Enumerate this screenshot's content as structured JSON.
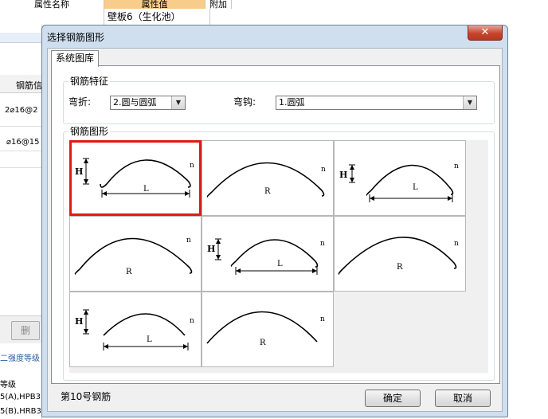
{
  "background": {
    "header_col1": "属性名称",
    "header_col2": "属性值",
    "header_col3": "附加",
    "row_value": "壁板6（生化池）",
    "left_col_header": "钢筋信",
    "left_cell1": "2⌀16@2",
    "left_cell2": "⌀16@15",
    "left_button": "删",
    "left_link": "二强度等级",
    "left_text1": "等级",
    "left_text2": "5(A),HPB3",
    "left_text3": "5(B),HRB3"
  },
  "dialog": {
    "title": "选择钢筋图形",
    "close_symbol": "✕",
    "tab_label": "系统图库",
    "features_group_label": "钢筋特征",
    "bend_label": "弯折:",
    "bend_value": "2.圆与圆弧",
    "hook_label": "弯钩:",
    "hook_value": "1.圆弧",
    "shapes_group_label": "钢筋图形",
    "status": "第10号钢筋",
    "ok_label": "确定",
    "cancel_label": "取消",
    "selected_color": "#e01818",
    "icons": {
      "dropdown": "chevron-down-icon",
      "close": "close-icon"
    }
  },
  "shapes": [
    {
      "labels": [
        "H",
        "L",
        "n"
      ],
      "selected": true
    },
    {
      "labels": [
        "R",
        "n"
      ],
      "selected": false
    },
    {
      "labels": [
        "H",
        "L",
        "n"
      ],
      "selected": false
    },
    {
      "labels": [
        "R",
        "n"
      ],
      "selected": false
    },
    {
      "labels": [
        "H",
        "L",
        "n"
      ],
      "selected": false
    },
    {
      "labels": [
        "R",
        "n"
      ],
      "selected": false
    },
    {
      "labels": [
        "H",
        "L",
        "n"
      ],
      "selected": false
    },
    {
      "labels": [
        "R",
        "n"
      ],
      "selected": false
    }
  ]
}
